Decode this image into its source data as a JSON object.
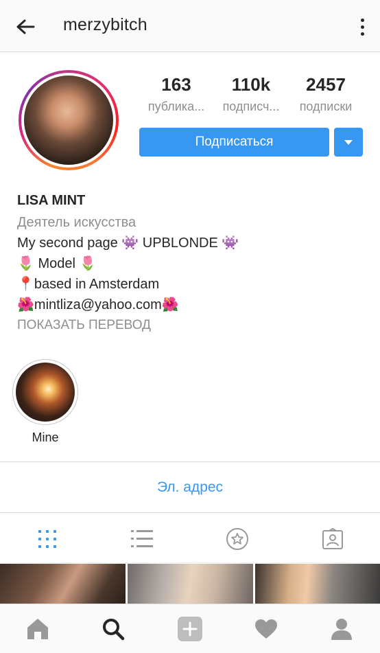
{
  "header": {
    "username": "merzybitch",
    "back_icon": "back-arrow-icon",
    "more_icon": "more-vertical-icon"
  },
  "profile": {
    "stats": [
      {
        "value": "163",
        "label": "публика..."
      },
      {
        "value": "110k",
        "label": "подписч..."
      },
      {
        "value": "2457",
        "label": "подписки"
      }
    ],
    "follow_label": "Подписаться",
    "dropdown_icon": "caret-down-icon"
  },
  "bio": {
    "name": "LISA MINT",
    "category": "Деятель искусства",
    "lines": [
      "My second page 👾 UPBLONDE 👾",
      "🌷 Model 🌷",
      "📍based in Amsterdam",
      "🌺mintliza@yahoo.com🌺"
    ],
    "translate": "ПОКАЗАТЬ ПЕРЕВОД"
  },
  "highlights": [
    {
      "label": "Mine"
    }
  ],
  "contact": {
    "email_label": "Эл. адрес"
  },
  "tabs": [
    {
      "icon": "grid-icon",
      "active": true
    },
    {
      "icon": "list-icon",
      "active": false
    },
    {
      "icon": "star-icon",
      "active": false
    },
    {
      "icon": "tagged-icon",
      "active": false
    }
  ],
  "colors": {
    "accent": "#3897f0",
    "text": "#262626",
    "secondary_text": "#8e8e8e",
    "inactive_icon": "#999999"
  },
  "bottom_nav": [
    {
      "icon": "home-icon"
    },
    {
      "icon": "search-icon",
      "active": true
    },
    {
      "icon": "add-post-icon"
    },
    {
      "icon": "heart-icon"
    },
    {
      "icon": "profile-icon"
    }
  ]
}
